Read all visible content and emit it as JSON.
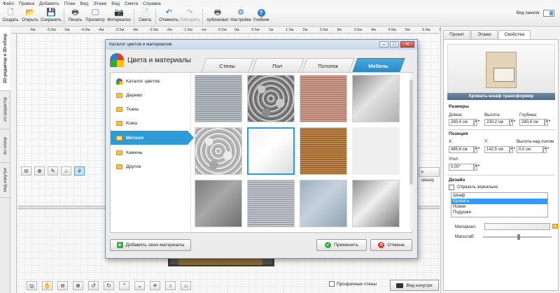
{
  "menu": [
    "Файл",
    "Правка",
    "Добавить",
    "План",
    "Вид",
    "Этажи",
    "Вид",
    "Смета",
    "Справка"
  ],
  "toolbar": {
    "create": "Создать",
    "open": "Открыть",
    "save": "Сохранить",
    "print": "Печать",
    "preview": "Просмотр",
    "photoreal": "Фотореализ",
    "estimate": "Смета",
    "undo": "Отменить",
    "redo": "Повторить",
    "publish": "публиковат",
    "settings": "Настройки",
    "help": "Учебник",
    "view_panel_label": "Вид панели:"
  },
  "left_tabs": [
    "2D-редактор и 3D-обзор",
    "2D-редактор",
    "3D-обзор",
    "Вид изнутри"
  ],
  "ruler": [
    "-6м",
    "-5.5м",
    "-5м",
    "-4.5м",
    "-4м",
    "-3.5м",
    "-3м",
    "-2.5м",
    "-2м",
    "-1.5м",
    "-1м",
    "-0.5м",
    "0м",
    "0.5м",
    "1м",
    "1.5м",
    "2м",
    "2.5м",
    "3м",
    "3.5м",
    "4м",
    "4.5м",
    "5м",
    "5.5м",
    "6м",
    "6.5м"
  ],
  "canvas": {
    "roof_button": "ь крышу",
    "transparent_walls": "Прозрачные стены",
    "inside_view": "Вид изнутри"
  },
  "right_panel": {
    "tabs": [
      "Проект",
      "Этажи",
      "Свойства"
    ],
    "active_tab": "Свойства",
    "object_name": "Кровать-шкаф трансформер",
    "size": {
      "title": "Размеры",
      "length_label": "Длина:",
      "length": "280,4 см",
      "height_label": "Высота:",
      "height": "230,2 см",
      "depth_label": "Глубина:",
      "depth": "240,4 см"
    },
    "position": {
      "title": "Позиция",
      "x_label": "X:",
      "x": "485,6 см",
      "y_label": "Y:",
      "y": "142,5 см",
      "floor_height_label": "Высота над полом",
      "floor_height": "0,0 см",
      "angle_label": "Угол:",
      "angle": "0,00°"
    },
    "design": {
      "title": "Дизайн",
      "mirror_label": "Отразить зеркально",
      "parts": [
        "Шкаф",
        "Кровать",
        "Ножки",
        "Подушки"
      ],
      "selected_part": "Кровать",
      "material_label": "Материал:",
      "scale_label": "Масштаб:"
    }
  },
  "dialog": {
    "window_title": "Каталог цветов и материалов",
    "header": "Цвета и материалы",
    "tabs": [
      "Стены",
      "Пол",
      "Потолок",
      "Мебель"
    ],
    "active_tab": "Мебель",
    "categories": [
      "Каталог цветов",
      "Дерево",
      "Ткань",
      "Кожа",
      "Металл",
      "Камень",
      "Другое"
    ],
    "active_category": "Металл",
    "tiles": [
      {
        "name": "brushed-steel",
        "colors": [
          "#9ea4ab",
          "#c7ccd1",
          "#8f969e"
        ]
      },
      {
        "name": "hammered-metal",
        "colors": [
          "#6b6b6b",
          "#c9c9c9",
          "#8a8a8a"
        ]
      },
      {
        "name": "copper",
        "colors": [
          "#a9766a",
          "#d6a698",
          "#c08c7c"
        ]
      },
      {
        "name": "polished-steel",
        "colors": [
          "#8a8a8a",
          "#e3e3e3",
          "#b0b0b0"
        ]
      },
      {
        "name": "embossed-silver",
        "colors": [
          "#b8b8b8",
          "#ececec",
          "#a4a4a4"
        ]
      },
      {
        "name": "chrome",
        "colors": [
          "#f4f4f4",
          "#ffffff",
          "#dcdcdc"
        ]
      },
      {
        "name": "bronze",
        "colors": [
          "#8b5a2b",
          "#d39a5a",
          "#a96e36"
        ]
      },
      {
        "name": "empty",
        "colors": [
          "#efefef",
          "#efefef",
          "#efefef"
        ]
      },
      {
        "name": "dark-steel",
        "colors": [
          "#7c7c7c",
          "#a8a8a8",
          "#6f6f6f"
        ]
      },
      {
        "name": "satin-silver",
        "colors": [
          "#a5a8af",
          "#d3d5da",
          "#9a9ea6"
        ]
      },
      {
        "name": "blue-steel",
        "colors": [
          "#9db0bf",
          "#c5d2dc",
          "#8fa2b3"
        ]
      },
      {
        "name": "mirror-steel",
        "colors": [
          "#8f8f8f",
          "#f0f0f0",
          "#7a7a7a"
        ]
      }
    ],
    "selected_tile": "chrome",
    "add_button": "Добавить свои материалы",
    "apply_button": "Применить",
    "cancel_button": "Отмена"
  }
}
